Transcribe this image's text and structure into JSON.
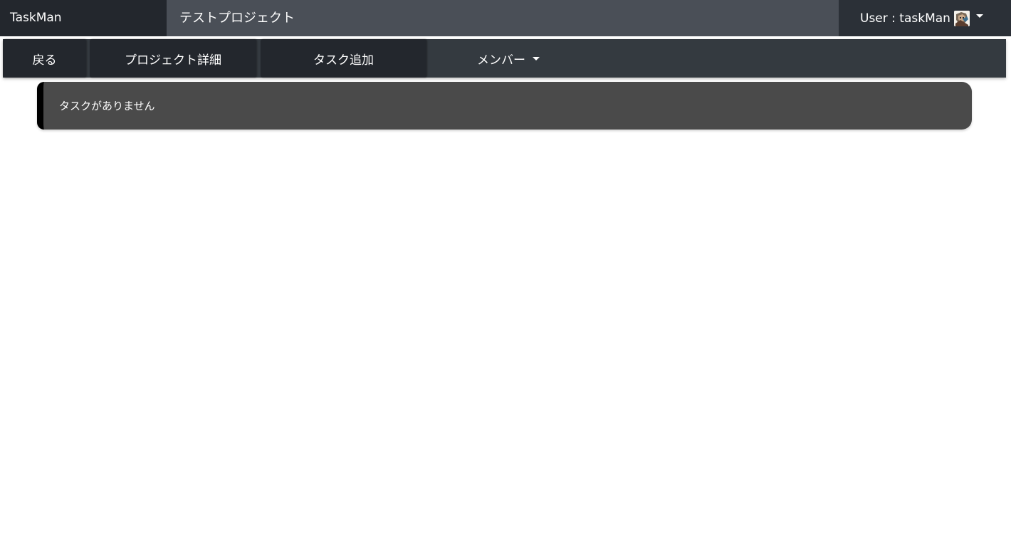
{
  "header": {
    "brand": "TaskMan",
    "project_title": "テストプロジェクト",
    "user_label": "User : taskMan",
    "user_menu_icon": "caret-down-icon",
    "avatar_icon": "avatar-icon"
  },
  "subnav": {
    "back_label": "戻る",
    "project_detail_label": "プロジェクト詳細",
    "add_task_label": "タスク追加",
    "members_label": "メンバー",
    "members_icon": "caret-down-icon"
  },
  "main": {
    "empty_message": "タスクがありません"
  },
  "colors": {
    "topbar": "#2b3037",
    "brand_bg": "#23272d",
    "project_title_bg": "#4a4f57",
    "subnav_bg": "#343a40",
    "button_bg": "#23272d",
    "alert_bg": "#4a4a4a",
    "alert_border": "#000000",
    "text": "#ffffff"
  }
}
